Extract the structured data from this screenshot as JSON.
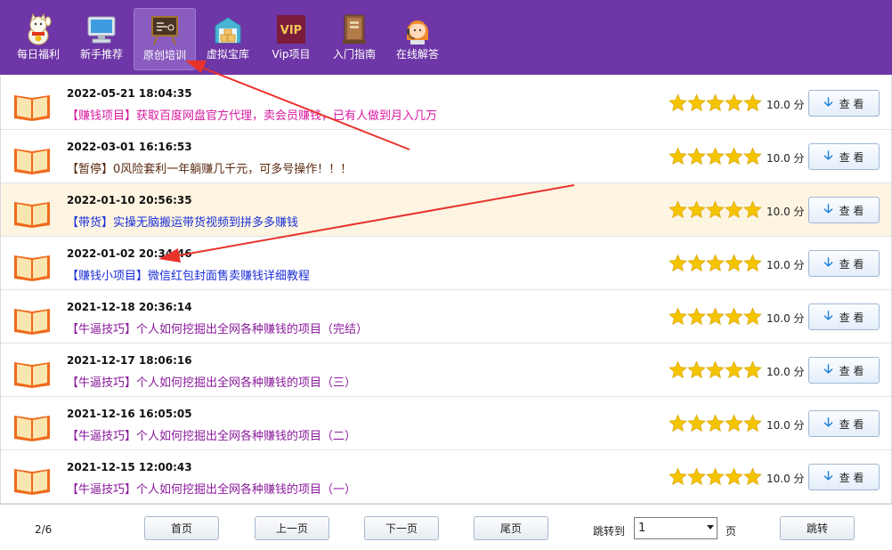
{
  "toolbar": {
    "items": [
      {
        "label": "每日福利",
        "icon": "lucky-cat-icon"
      },
      {
        "label": "新手推荐",
        "icon": "monitor-icon"
      },
      {
        "label": "原创培训",
        "icon": "chalkboard-icon",
        "active": true
      },
      {
        "label": "虚拟宝库",
        "icon": "warehouse-icon"
      },
      {
        "label": "Vip项目",
        "icon": "vip-icon"
      },
      {
        "label": "入门指南",
        "icon": "books-icon"
      },
      {
        "label": "在线解答",
        "icon": "support-agent-icon"
      }
    ],
    "vip_badge_text": "VIP"
  },
  "list": {
    "rows": [
      {
        "date": "2022-05-21 18:04:35",
        "title": "【赚钱项目】获取百度网盘官方代理，卖会员赚钱，已有人做到月入几万",
        "score": "10.0 分",
        "view": "查 看"
      },
      {
        "date": "2022-03-01 16:16:53",
        "title": "【暂停】0风险套利一年躺赚几千元，可多号操作！！！",
        "score": "10.0 分",
        "view": "查 看"
      },
      {
        "date": "2022-01-10 20:56:35",
        "title": "【带货】实操无脑搬运带货视频到拼多多赚钱",
        "score": "10.0 分",
        "view": "查 看"
      },
      {
        "date": "2022-01-02 20:34:46",
        "title": "【赚钱小项目】微信红包封面售卖赚钱详细教程",
        "score": "10.0 分",
        "view": "查 看"
      },
      {
        "date": "2021-12-18 20:36:14",
        "title": "【牛逼技巧】个人如何挖掘出全网各种赚钱的项目（完结）",
        "score": "10.0 分",
        "view": "查 看"
      },
      {
        "date": "2021-12-17 18:06:16",
        "title": "【牛逼技巧】个人如何挖掘出全网各种赚钱的项目（三）",
        "score": "10.0 分",
        "view": "查 看"
      },
      {
        "date": "2021-12-16 16:05:05",
        "title": "【牛逼技巧】个人如何挖掘出全网各种赚钱的项目（二）",
        "score": "10.0 分",
        "view": "查 看"
      },
      {
        "date": "2021-12-15 12:00:43",
        "title": "【牛逼技巧】个人如何挖掘出全网各种赚钱的项目（一）",
        "score": "10.0 分",
        "view": "查 看"
      }
    ],
    "rating_stars": 5,
    "colors": {
      "title_pink": "#d8199f",
      "title_gray": "#5a2a10",
      "title_blue": "#1c2fd6",
      "title_purple": "#8b1a9c",
      "highlight_row": "#fdf5e2",
      "star": "#f5c400",
      "toolbar_bg": "#6e36a6",
      "arrow": "#e8332c"
    }
  },
  "pager": {
    "page_info": "2/6",
    "first": "首页",
    "prev": "上一页",
    "next": "下一页",
    "last": "尾页",
    "jump_label": "跳转到",
    "page_value": "1",
    "page_unit": "页",
    "jump_button": "跳转"
  }
}
